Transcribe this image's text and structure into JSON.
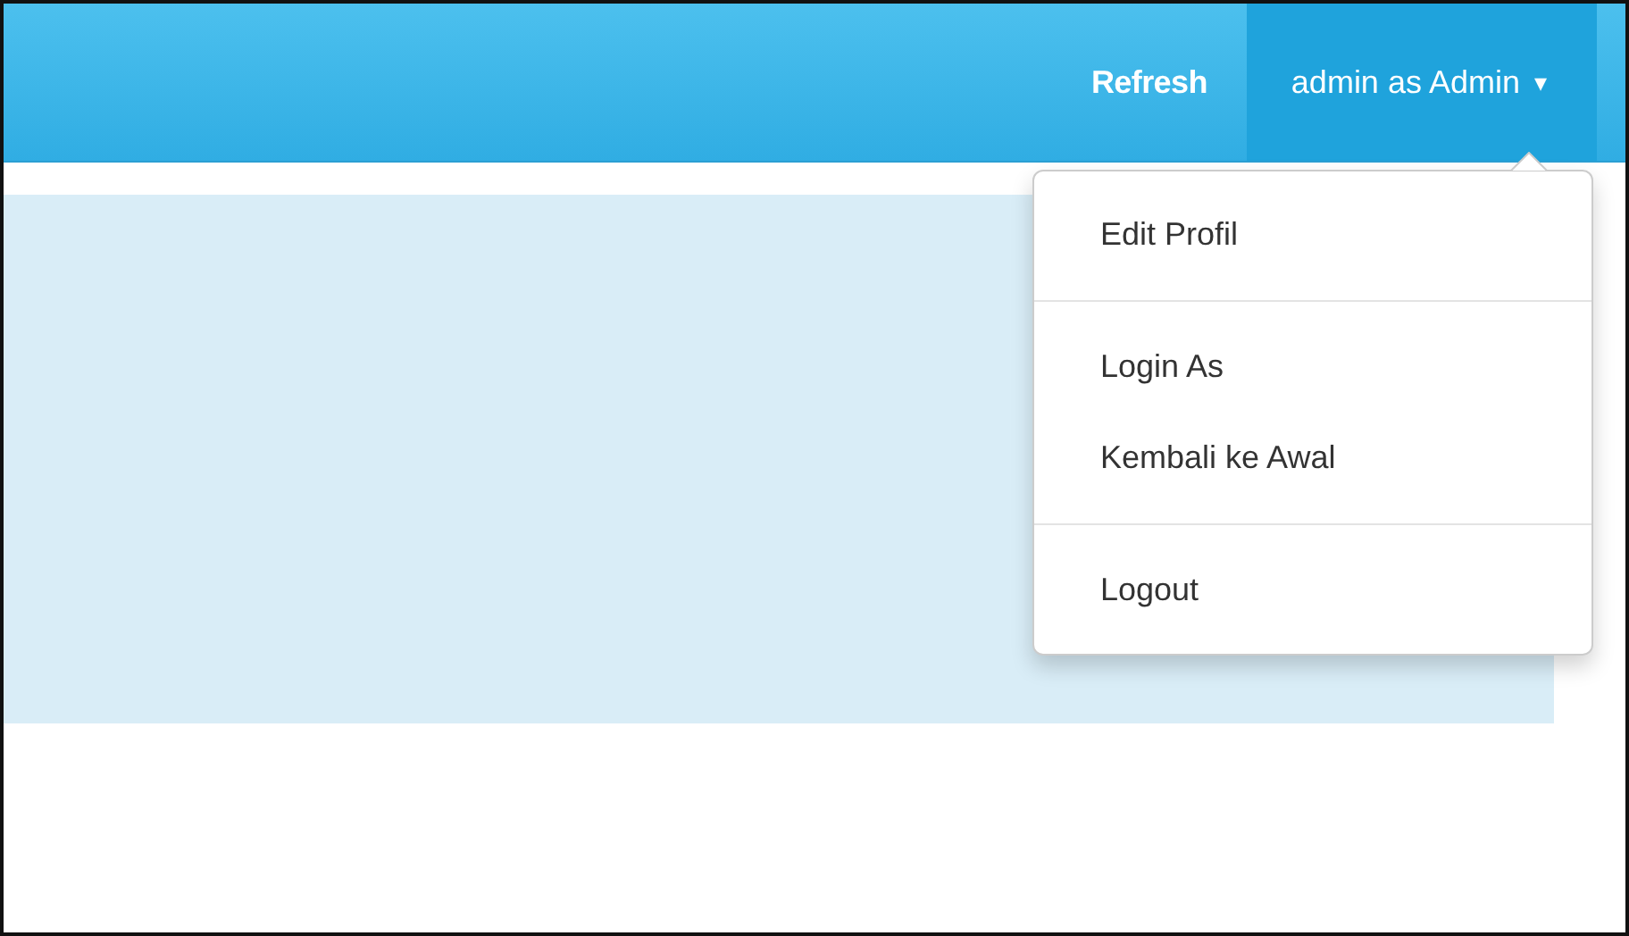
{
  "navbar": {
    "links": [
      {
        "label": "Refresh"
      }
    ],
    "user_menu": {
      "label": "admin as Admin",
      "caret": "▾",
      "expanded": true
    }
  },
  "dropdown": {
    "items": [
      {
        "kind": "item",
        "label": "Edit Profil"
      },
      {
        "kind": "divider"
      },
      {
        "kind": "item",
        "label": "Login As"
      },
      {
        "kind": "item",
        "label": "Kembali ke Awal"
      },
      {
        "kind": "divider"
      },
      {
        "kind": "item",
        "label": "Logout"
      }
    ]
  }
}
